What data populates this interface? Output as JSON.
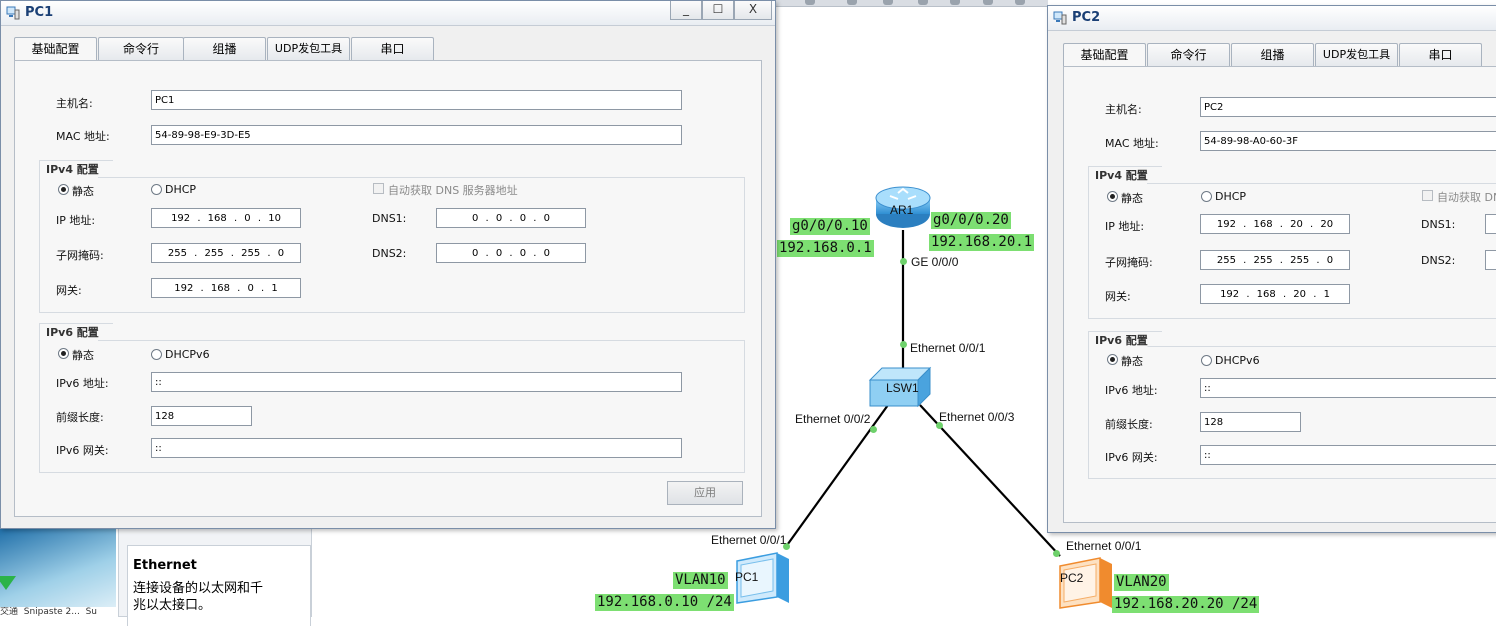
{
  "colors": {
    "highlight": "#7ddf72",
    "link_dot": "#6ed16b",
    "title_text": "#1a3f75",
    "pc2_orange": "#f08b2e",
    "device_blue": "#3b9de0"
  },
  "pc1": {
    "title": "PC1",
    "window_buttons": {
      "minimize": "_",
      "maximize": "☐",
      "close": "X"
    },
    "tabs": [
      "基础配置",
      "命令行",
      "组播",
      "UDP发包工具",
      "串口"
    ],
    "hostname_label": "主机名:",
    "hostname": "PC1",
    "mac_label": "MAC 地址:",
    "mac": "54-89-98-E9-3D-E5",
    "ipv4_title": "IPv4 配置",
    "static_label": "静态",
    "dhcp_label": "DHCP",
    "auto_dns_label": "自动获取 DNS 服务器地址",
    "ip_label": "IP 地址:",
    "ip": "192  .  168  .   0   .  10",
    "mask_label": "子网掩码:",
    "mask": "255  .  255  .  255  .   0",
    "gateway_label": "网关:",
    "gateway": "192  .  168  .   0   .   1",
    "dns1_label": "DNS1:",
    "dns1": "0   .   0   .   0   .   0",
    "dns2_label": "DNS2:",
    "dns2": "0   .   0   .   0   .   0",
    "ipv6_title": "IPv6 配置",
    "dhcpv6_label": "DHCPv6",
    "ipv6_label": "IPv6 地址:",
    "ipv6": "::",
    "prefix_label": "前缀长度:",
    "prefix": "128",
    "ipv6_gw_label": "IPv6 网关:",
    "ipv6_gw": "::",
    "apply_label": "应用"
  },
  "pc2": {
    "title": "PC2",
    "tabs": [
      "基础配置",
      "命令行",
      "组播",
      "UDP发包工具",
      "串口"
    ],
    "hostname_label": "主机名:",
    "hostname": "PC2",
    "mac_label": "MAC 地址:",
    "mac": "54-89-98-A0-60-3F",
    "ipv4_title": "IPv4 配置",
    "static_label": "静态",
    "dhcp_label": "DHCP",
    "auto_dns_label": "自动获取 DN",
    "ip_label": "IP 地址:",
    "ip": "192  .  168  .  20  .  20",
    "mask_label": "子网掩码:",
    "mask": "255  .  255  .  255  .   0",
    "gateway_label": "网关:",
    "gateway": "192  .  168  .  20  .   1",
    "dns1_label": "DNS1:",
    "dns2_label": "DNS2:",
    "ipv6_title": "IPv6 配置",
    "dhcpv6_label": "DHCPv6",
    "ipv6_label": "IPv6 地址:",
    "ipv6": "::",
    "prefix_label": "前缀长度:",
    "prefix": "128",
    "ipv6_gw_label": "IPv6 网关:",
    "ipv6_gw": "::"
  },
  "topology": {
    "ar1": {
      "name": "AR1",
      "port": "GE 0/0/0",
      "sub1": "g0/0/0.10",
      "sub1_ip": "192.168.0.1",
      "sub2": "g0/0/0.20",
      "sub2_ip": "192.168.20.1"
    },
    "lsw1": {
      "name": "LSW1",
      "port_up": "Ethernet 0/0/1",
      "port_left": "Ethernet 0/0/2",
      "port_right": "Ethernet 0/0/3"
    },
    "pc1_node": {
      "name": "PC1",
      "port": "Ethernet 0/0/1",
      "vlan": "VLAN10",
      "ip": "192.168.0.10 /24"
    },
    "pc2_node": {
      "name": "PC2",
      "port": "Ethernet 0/0/1",
      "vlan": "VLAN20",
      "ip": "192.168.20.20 /24"
    }
  },
  "info_panel": {
    "title": "Ethernet",
    "description_line1": "连接设备的以太网和千",
    "description_line2": "兆以太接口。"
  },
  "thumbnail": {
    "captions": [
      "交通",
      "Snipaste 2...",
      "Su"
    ]
  }
}
